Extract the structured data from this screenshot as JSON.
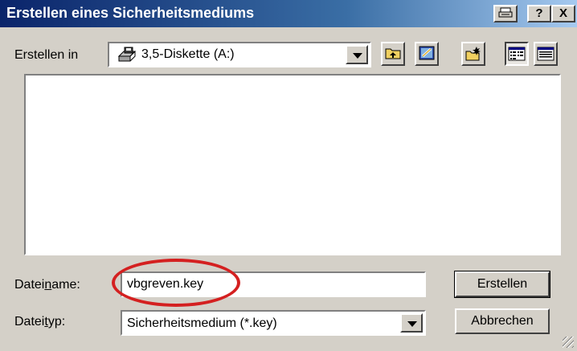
{
  "window": {
    "title": "Erstellen eines Sicherheitsmediums",
    "help_button": "?",
    "close_button": "X"
  },
  "location": {
    "label": "Erstellen in",
    "selected": "3,5-Diskette (A:)",
    "icon": "floppy-drive-icon"
  },
  "toolbar": {
    "buttons": [
      {
        "name": "up-one-level",
        "icon": "folder-up-icon"
      },
      {
        "name": "desktop",
        "icon": "desktop-icon"
      },
      {
        "name": "new-folder",
        "icon": "new-folder-icon"
      },
      {
        "name": "list-view",
        "icon": "list-view-icon",
        "pressed": true
      },
      {
        "name": "details-view",
        "icon": "details-view-icon",
        "pressed": false
      }
    ]
  },
  "filename": {
    "label_pre": "Datei",
    "label_u": "n",
    "label_post": "ame:",
    "value": "vbgreven.key"
  },
  "filetype": {
    "label_pre": "Datei",
    "label_u": "t",
    "label_post": "yp:",
    "selected": "Sicherheitsmedium (*.key)"
  },
  "actions": {
    "create": "Erstellen",
    "cancel": "Abbrechen"
  },
  "colors": {
    "titlebar_start": "#0a246a",
    "titlebar_end": "#a6caf0",
    "face": "#d4d0c8",
    "highlight_ellipse": "#d42020"
  }
}
